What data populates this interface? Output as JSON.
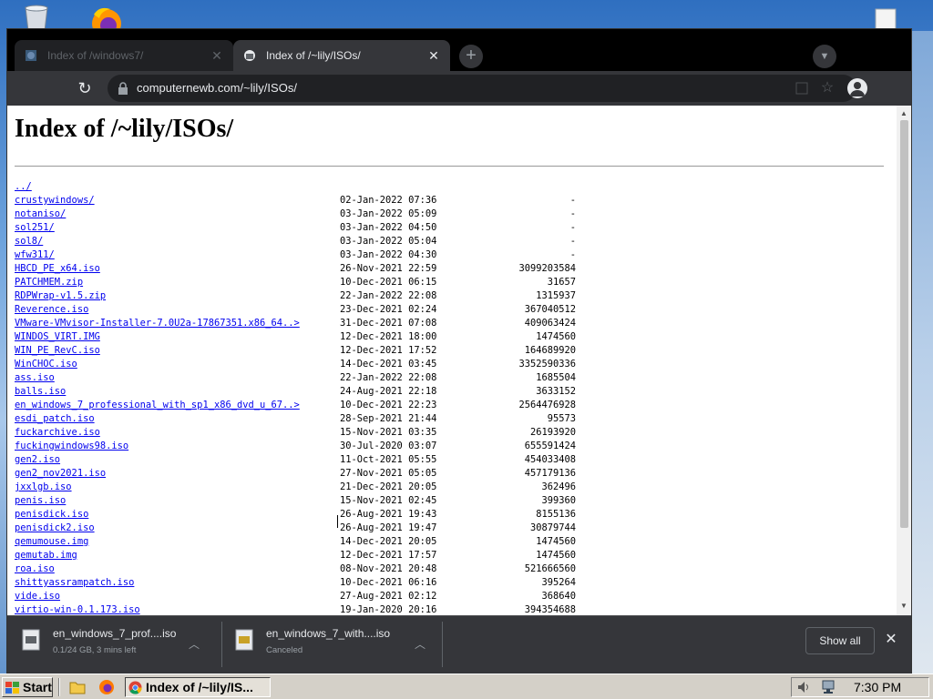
{
  "browser": {
    "tabs": [
      {
        "title": "Index of /windows7/",
        "active": false
      },
      {
        "title": "Index of /~lily/ISOs/",
        "active": true
      }
    ],
    "url": "computernewb.com/~lily/ISOs/"
  },
  "page": {
    "title": "Index of /~lily/ISOs/",
    "entries": [
      {
        "name": "../",
        "date": "",
        "size": ""
      },
      {
        "name": "crustywindows/",
        "date": "02-Jan-2022 07:36",
        "size": "-"
      },
      {
        "name": "notaniso/",
        "date": "03-Jan-2022 05:09",
        "size": "-"
      },
      {
        "name": "sol251/",
        "date": "03-Jan-2022 04:50",
        "size": "-"
      },
      {
        "name": "sol8/",
        "date": "03-Jan-2022 05:04",
        "size": "-"
      },
      {
        "name": "wfw311/",
        "date": "03-Jan-2022 04:30",
        "size": "-"
      },
      {
        "name": "HBCD_PE_x64.iso",
        "date": "26-Nov-2021 22:59",
        "size": "3099203584"
      },
      {
        "name": "PATCHMEM.zip",
        "date": "10-Dec-2021 06:15",
        "size": "31657"
      },
      {
        "name": "RDPWrap-v1.5.zip",
        "date": "22-Jan-2022 22:08",
        "size": "1315937"
      },
      {
        "name": "Reverence.iso",
        "date": "23-Dec-2021 02:24",
        "size": "367040512"
      },
      {
        "name": "VMware-VMvisor-Installer-7.0U2a-17867351.x86_64..>",
        "date": "31-Dec-2021 07:08",
        "size": "409063424"
      },
      {
        "name": "WINDOS_VIRT.IMG",
        "date": "12-Dec-2021 18:00",
        "size": "1474560"
      },
      {
        "name": "WIN_PE_RevC.iso",
        "date": "12-Dec-2021 17:52",
        "size": "164689920"
      },
      {
        "name": "WinCHOC.iso",
        "date": "14-Dec-2021 03:45",
        "size": "3352590336"
      },
      {
        "name": "ass.iso",
        "date": "22-Jan-2022 22:08",
        "size": "1685504"
      },
      {
        "name": "balls.iso",
        "date": "24-Aug-2021 22:18",
        "size": "3633152"
      },
      {
        "name": "en_windows_7_professional_with_sp1_x86_dvd_u_67..>",
        "date": "10-Dec-2021 22:23",
        "size": "2564476928"
      },
      {
        "name": "esdi_patch.iso",
        "date": "28-Sep-2021 21:44",
        "size": "95573"
      },
      {
        "name": "fuckarchive.iso",
        "date": "15-Nov-2021 03:35",
        "size": "26193920"
      },
      {
        "name": "fuckingwindows98.iso",
        "date": "30-Jul-2020 03:07",
        "size": "655591424"
      },
      {
        "name": "gen2.iso",
        "date": "11-Oct-2021 05:55",
        "size": "454033408"
      },
      {
        "name": "gen2_nov2021.iso",
        "date": "27-Nov-2021 05:05",
        "size": "457179136"
      },
      {
        "name": "jxxlgb.iso",
        "date": "21-Dec-2021 20:05",
        "size": "362496"
      },
      {
        "name": "penis.iso",
        "date": "15-Nov-2021 02:45",
        "size": "399360"
      },
      {
        "name": "penisdick.iso",
        "date": "26-Aug-2021 19:43",
        "size": "8155136"
      },
      {
        "name": "penisdick2.iso",
        "date": "26-Aug-2021 19:47",
        "size": "30879744"
      },
      {
        "name": "qemumouse.img",
        "date": "14-Dec-2021 20:05",
        "size": "1474560"
      },
      {
        "name": "qemutab.img",
        "date": "12-Dec-2021 17:57",
        "size": "1474560"
      },
      {
        "name": "roa.iso",
        "date": "08-Nov-2021 20:48",
        "size": "521666560"
      },
      {
        "name": "shittyassrampatch.iso",
        "date": "10-Dec-2021 06:16",
        "size": "395264"
      },
      {
        "name": "vide.iso",
        "date": "27-Aug-2021 02:12",
        "size": "368640"
      },
      {
        "name": "virtio-win-0.1.173.iso",
        "date": "19-Jan-2020 20:16",
        "size": "394354688"
      }
    ]
  },
  "downloads": {
    "items": [
      {
        "name": "en_windows_7_prof....iso",
        "status": "0.1/24 GB, 3 mins left"
      },
      {
        "name": "en_windows_7_with....iso",
        "status": "Canceled"
      }
    ],
    "show_all_label": "Show all"
  },
  "taskbar": {
    "start_label": "Start",
    "task_label": "Index of /~lily/IS...",
    "clock": "7:30 PM"
  },
  "colors": {
    "link": "#0000ee",
    "chrome_dark": "#35363a",
    "taskbar": "#d4d0c8"
  },
  "icons": [
    "recycle-bin-icon",
    "firefox-icon",
    "file-icon",
    "globe-favicon",
    "server-favicon",
    "reload-icon",
    "lock-icon",
    "install-icon",
    "star-icon",
    "profile-icon",
    "iso-file-icon",
    "chevron-up-icon",
    "close-icon",
    "windows-flag-icon",
    "explorer-icon",
    "chrome-icon",
    "volume-icon",
    "network-icon"
  ]
}
